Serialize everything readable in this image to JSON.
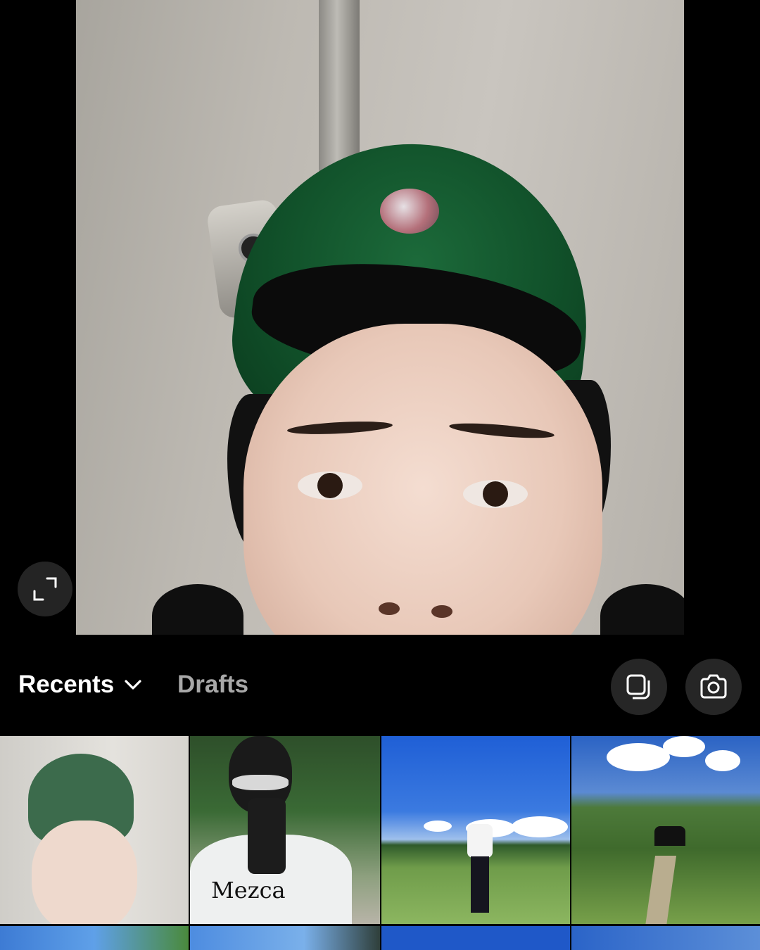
{
  "preview": {
    "alt": "selected photo preview"
  },
  "toolbar": {
    "album_label": "Recents",
    "drafts_label": "Drafts"
  },
  "grid": {
    "thumbnails": [
      {
        "name": "thumbnail-selfie"
      },
      {
        "name": "thumbnail-mirror-selfie",
        "shirt_text": "Mezca"
      },
      {
        "name": "thumbnail-field-person"
      },
      {
        "name": "thumbnail-garden-path"
      },
      {
        "name": "thumbnail-sky-1"
      },
      {
        "name": "thumbnail-sky-2"
      },
      {
        "name": "thumbnail-sky-3"
      },
      {
        "name": "thumbnail-sky-4"
      }
    ]
  },
  "icons": {
    "expand": "expand-icon",
    "chevron": "chevron-down-icon",
    "multi_select": "multi-select-icon",
    "camera": "camera-icon"
  },
  "colors": {
    "background": "#000000",
    "button_bg": "#262626",
    "primary_text": "#ffffff",
    "secondary_text": "#a8a8a8"
  }
}
